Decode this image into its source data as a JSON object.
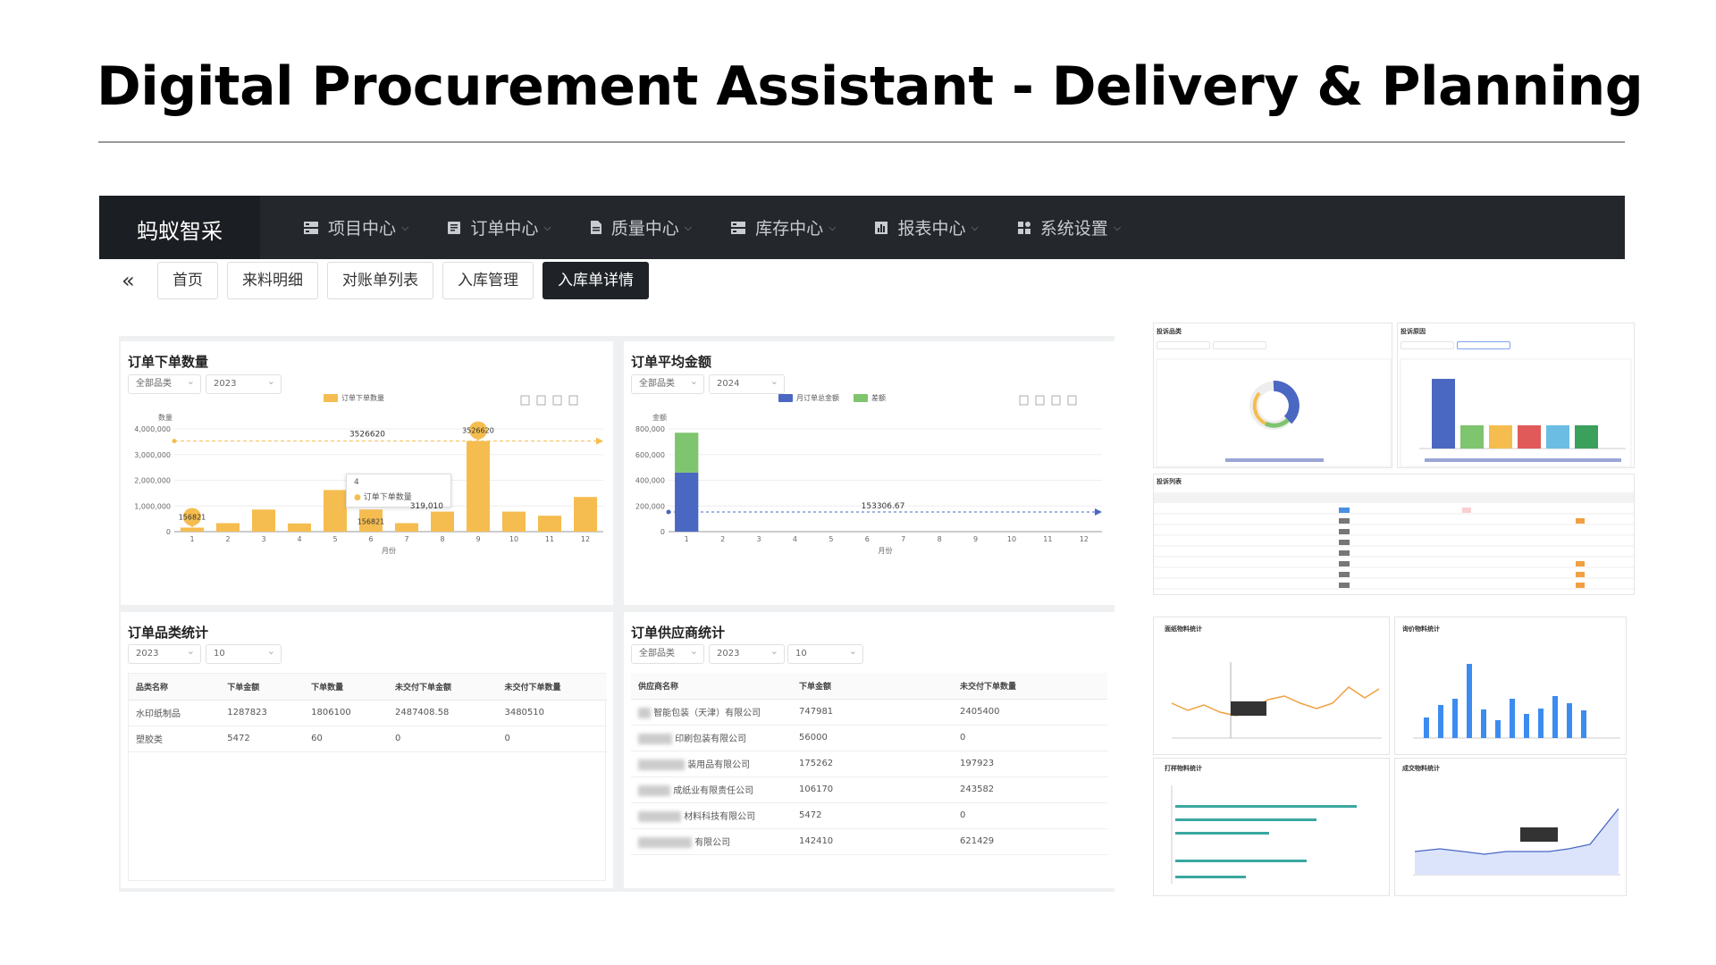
{
  "slide": {
    "title": "Digital Procurement Assistant - Delivery & Planning"
  },
  "app": {
    "logo": "蚂蚁智采",
    "menu": [
      {
        "label": "项目中心",
        "icon": "project-icon"
      },
      {
        "label": "订单中心",
        "icon": "order-icon"
      },
      {
        "label": "质量中心",
        "icon": "quality-icon"
      },
      {
        "label": "库存中心",
        "icon": "inventory-icon"
      },
      {
        "label": "报表中心",
        "icon": "report-icon"
      },
      {
        "label": "系统设置",
        "icon": "settings-icon"
      }
    ],
    "tabs": [
      "首页",
      "来料明细",
      "对账单列表",
      "入库管理",
      "入库单详情"
    ],
    "active_tab": "入库单详情"
  },
  "order_qty_panel": {
    "title": "订单下单数量",
    "filters": [
      "全部品类",
      "2023"
    ],
    "ylabel": "数量",
    "xlabel": "月份",
    "tooltip": {
      "month": "4",
      "label": "订单下单数量",
      "value": "319,010"
    }
  },
  "avg_amount_panel": {
    "title": "订单平均金额",
    "filters": [
      "全部品类",
      "2024"
    ],
    "ylabel": "金额",
    "xlabel": "月份"
  },
  "category_panel": {
    "title": "订单品类统计",
    "filters": [
      "2023",
      "10"
    ],
    "columns": [
      "品类名称",
      "下单金额",
      "下单数量",
      "未交付下单金额",
      "未交付下单数量"
    ],
    "rows": [
      [
        "水印纸制品",
        "1287823",
        "1806100",
        "2487408.58",
        "3480510"
      ],
      [
        "塑胶类",
        "5472",
        "60",
        "0",
        "0"
      ]
    ]
  },
  "supplier_panel": {
    "title": "订单供应商统计",
    "filters": [
      "全部品类",
      "2023",
      "10"
    ],
    "columns": [
      "供应商名称",
      "下单金额",
      "未交付下单数量"
    ],
    "rows": [
      [
        "智能包装（天津）有限公司",
        "747981",
        "2405400"
      ],
      [
        "印刷包装有限公司",
        "56000",
        "0"
      ],
      [
        "装用品有限公司",
        "175262",
        "197923"
      ],
      [
        "成纸业有限责任公司",
        "106170",
        "243582"
      ],
      [
        "材料科技有限公司",
        "5472",
        "0"
      ],
      [
        "有限公司",
        "142410",
        "621429"
      ]
    ]
  },
  "thumbnails": {
    "complaint_category": "投诉品类",
    "complaint_reason": "投诉原因",
    "complaint_list": "投诉列表",
    "stats": [
      "面纸物料统计",
      "询价物料统计",
      "打样物料统计",
      "成交物料统计"
    ]
  },
  "chart_data": [
    {
      "type": "bar",
      "title": "订单下单数量",
      "xlabel": "月份",
      "ylabel": "数量",
      "categories": [
        "1",
        "2",
        "3",
        "4",
        "5",
        "6",
        "7",
        "8",
        "9",
        "10",
        "11",
        "12"
      ],
      "series": [
        {
          "name": "订单下单数量",
          "values": [
            156821,
            330000,
            860000,
            319010,
            1620000,
            860000,
            330000,
            780000,
            3526620,
            780000,
            620000,
            1350000
          ]
        }
      ],
      "average": 3526620,
      "annotations": [
        "3526620",
        "156821"
      ],
      "ylim": [
        0,
        4000000
      ],
      "yticks": [
        "0",
        "1,000,000",
        "2,000,000",
        "3,000,000",
        "4,000,000"
      ],
      "color": "#f5bd4f"
    },
    {
      "type": "bar",
      "title": "订单平均金额",
      "xlabel": "月份",
      "ylabel": "金额",
      "categories": [
        "1",
        "2",
        "3",
        "4",
        "5",
        "6",
        "7",
        "8",
        "9",
        "10",
        "11",
        "12"
      ],
      "series": [
        {
          "name": "月订单总金额",
          "values": [
            460000,
            0,
            0,
            0,
            0,
            0,
            0,
            0,
            0,
            0,
            0,
            0
          ],
          "color": "#4a67c2"
        },
        {
          "name": "差额",
          "values": [
            310000,
            0,
            0,
            0,
            0,
            0,
            0,
            0,
            0,
            0,
            0,
            0
          ],
          "color": "#7fc46e"
        }
      ],
      "average": 153306.67,
      "annotations": [
        "153306.67"
      ],
      "ylim": [
        0,
        800000
      ],
      "yticks": [
        "0",
        "200,000",
        "400,000",
        "600,000",
        "800,000"
      ]
    }
  ]
}
